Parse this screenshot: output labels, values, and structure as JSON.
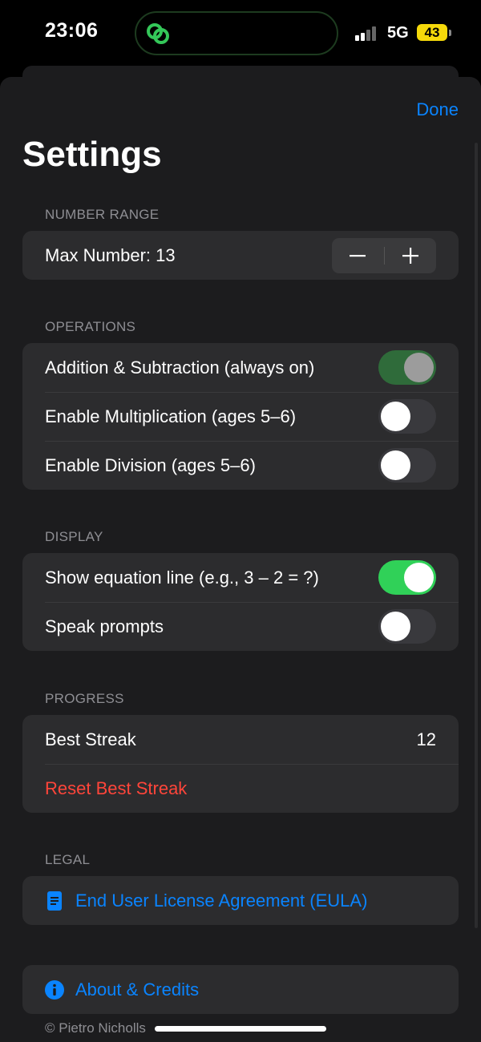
{
  "status": {
    "time": "23:06",
    "network": "5G",
    "battery": "43"
  },
  "header": {
    "done": "Done",
    "title": "Settings"
  },
  "number_range": {
    "header": "NUMBER RANGE",
    "max_label": "Max Number: 13",
    "minus": "−",
    "plus": "+"
  },
  "operations": {
    "header": "OPERATIONS",
    "items": [
      {
        "label": "Addition & Subtraction (always on)",
        "state": "on-disabled"
      },
      {
        "label": "Enable Multiplication (ages 5–6)",
        "state": "off"
      },
      {
        "label": "Enable Division (ages 5–6)",
        "state": "off"
      }
    ]
  },
  "display": {
    "header": "DISPLAY",
    "items": [
      {
        "label": "Show equation line (e.g., 3 – 2 = ?)",
        "state": "on"
      },
      {
        "label": "Speak prompts",
        "state": "off"
      }
    ]
  },
  "progress": {
    "header": "PROGRESS",
    "best_label": "Best Streak",
    "best_value": "12",
    "reset_label": "Reset Best Streak"
  },
  "legal": {
    "header": "LEGAL",
    "eula_label": "End User License Agreement (EULA)"
  },
  "about": {
    "label": "About & Credits"
  },
  "footer": {
    "text": "© Pietro Nicholls"
  },
  "colors": {
    "accent": "#0a84ff",
    "toggle_on": "#30d158",
    "destructive": "#ff453a",
    "background": "#1c1c1e",
    "group": "#2c2c2e"
  },
  "icons": {
    "island": "link-icon",
    "eula": "document-icon",
    "about": "info-icon"
  }
}
